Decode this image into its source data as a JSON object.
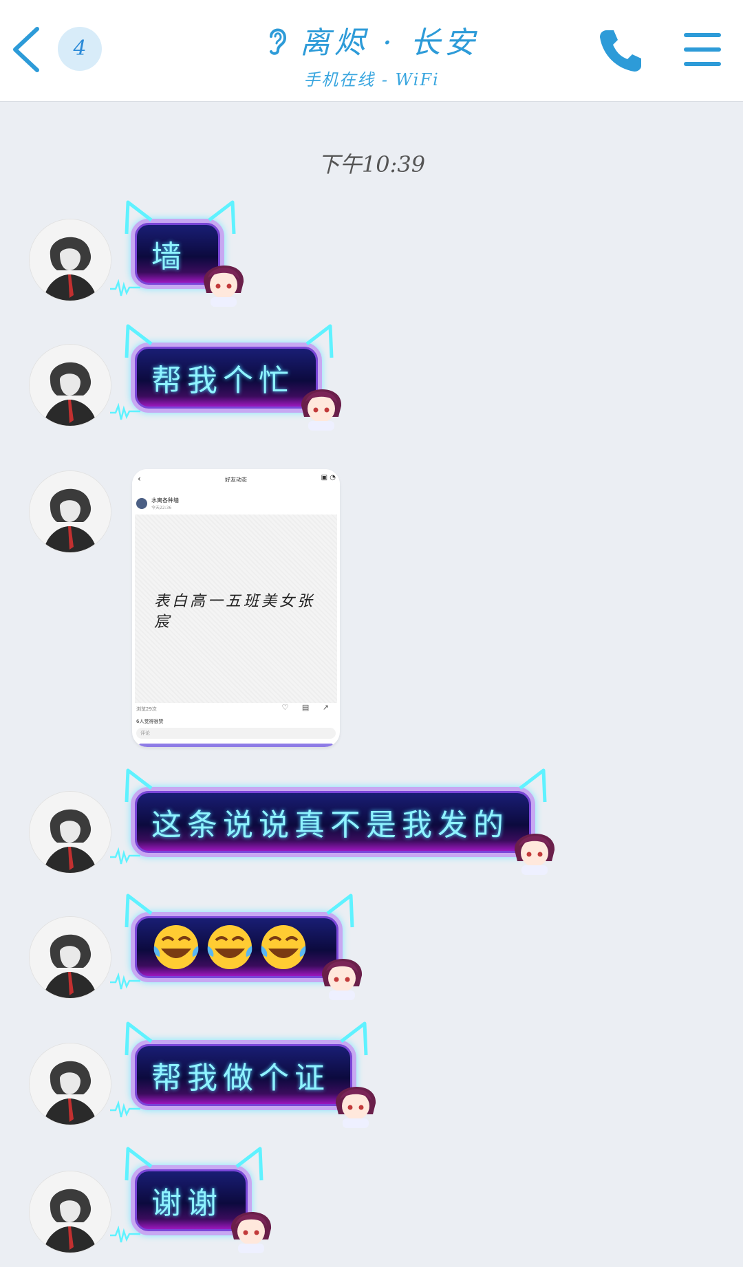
{
  "header": {
    "unread_count": "4",
    "contact_name": "离烬 · 长安",
    "status": "手机在线 - WiFi"
  },
  "timestamp": "下午10:39",
  "messages": [
    {
      "type": "text",
      "text": "墙"
    },
    {
      "type": "text",
      "text": "帮我个忙"
    },
    {
      "type": "image",
      "screenshot": {
        "page_title": "好友动态",
        "poster_name": "水离各种墙",
        "poster_time": "今天22:36",
        "post_text": "表白高一五班美女张宸",
        "footer_text": "浏览29次",
        "likes_text": "6人觉得很赞",
        "comment_placeholder": "评论"
      }
    },
    {
      "type": "text",
      "text": "这条说说真不是我发的"
    },
    {
      "type": "emoji",
      "emoji": "😂😂😂",
      "count": 3
    },
    {
      "type": "text",
      "text": "帮我做个证"
    },
    {
      "type": "text",
      "text": "谢谢"
    }
  ],
  "colors": {
    "accent": "#2d9bd8",
    "bubble_text": "#8ff3ff",
    "bubble_fill": "#0c0a3e",
    "bubble_border": "#c7a8f2",
    "background": "#ebeef3"
  },
  "icons": {
    "back": "chevron-left-icon",
    "phone": "phone-icon",
    "menu": "hamburger-menu-icon",
    "title_icon": "ear-icon"
  }
}
